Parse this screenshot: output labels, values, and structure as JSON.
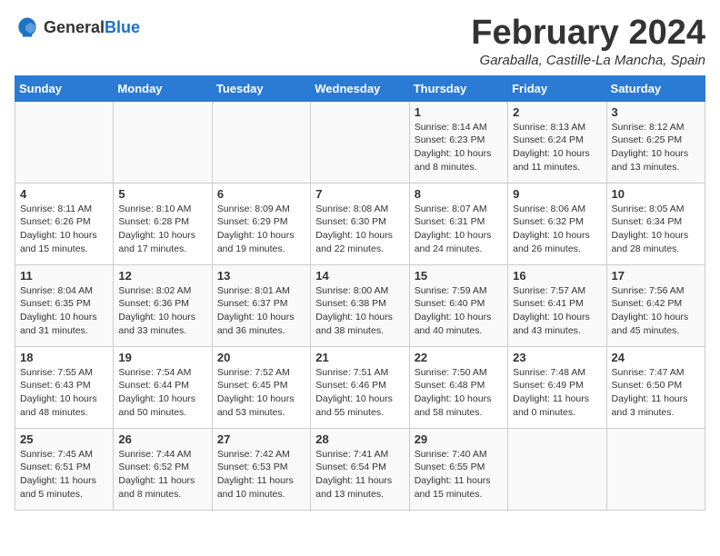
{
  "header": {
    "logo_general": "General",
    "logo_blue": "Blue",
    "month_year": "February 2024",
    "location": "Garaballa, Castille-La Mancha, Spain"
  },
  "days_of_week": [
    "Sunday",
    "Monday",
    "Tuesday",
    "Wednesday",
    "Thursday",
    "Friday",
    "Saturday"
  ],
  "weeks": [
    [
      {
        "day": "",
        "info": ""
      },
      {
        "day": "",
        "info": ""
      },
      {
        "day": "",
        "info": ""
      },
      {
        "day": "",
        "info": ""
      },
      {
        "day": "1",
        "info": "Sunrise: 8:14 AM\nSunset: 6:23 PM\nDaylight: 10 hours\nand 8 minutes."
      },
      {
        "day": "2",
        "info": "Sunrise: 8:13 AM\nSunset: 6:24 PM\nDaylight: 10 hours\nand 11 minutes."
      },
      {
        "day": "3",
        "info": "Sunrise: 8:12 AM\nSunset: 6:25 PM\nDaylight: 10 hours\nand 13 minutes."
      }
    ],
    [
      {
        "day": "4",
        "info": "Sunrise: 8:11 AM\nSunset: 6:26 PM\nDaylight: 10 hours\nand 15 minutes."
      },
      {
        "day": "5",
        "info": "Sunrise: 8:10 AM\nSunset: 6:28 PM\nDaylight: 10 hours\nand 17 minutes."
      },
      {
        "day": "6",
        "info": "Sunrise: 8:09 AM\nSunset: 6:29 PM\nDaylight: 10 hours\nand 19 minutes."
      },
      {
        "day": "7",
        "info": "Sunrise: 8:08 AM\nSunset: 6:30 PM\nDaylight: 10 hours\nand 22 minutes."
      },
      {
        "day": "8",
        "info": "Sunrise: 8:07 AM\nSunset: 6:31 PM\nDaylight: 10 hours\nand 24 minutes."
      },
      {
        "day": "9",
        "info": "Sunrise: 8:06 AM\nSunset: 6:32 PM\nDaylight: 10 hours\nand 26 minutes."
      },
      {
        "day": "10",
        "info": "Sunrise: 8:05 AM\nSunset: 6:34 PM\nDaylight: 10 hours\nand 28 minutes."
      }
    ],
    [
      {
        "day": "11",
        "info": "Sunrise: 8:04 AM\nSunset: 6:35 PM\nDaylight: 10 hours\nand 31 minutes."
      },
      {
        "day": "12",
        "info": "Sunrise: 8:02 AM\nSunset: 6:36 PM\nDaylight: 10 hours\nand 33 minutes."
      },
      {
        "day": "13",
        "info": "Sunrise: 8:01 AM\nSunset: 6:37 PM\nDaylight: 10 hours\nand 36 minutes."
      },
      {
        "day": "14",
        "info": "Sunrise: 8:00 AM\nSunset: 6:38 PM\nDaylight: 10 hours\nand 38 minutes."
      },
      {
        "day": "15",
        "info": "Sunrise: 7:59 AM\nSunset: 6:40 PM\nDaylight: 10 hours\nand 40 minutes."
      },
      {
        "day": "16",
        "info": "Sunrise: 7:57 AM\nSunset: 6:41 PM\nDaylight: 10 hours\nand 43 minutes."
      },
      {
        "day": "17",
        "info": "Sunrise: 7:56 AM\nSunset: 6:42 PM\nDaylight: 10 hours\nand 45 minutes."
      }
    ],
    [
      {
        "day": "18",
        "info": "Sunrise: 7:55 AM\nSunset: 6:43 PM\nDaylight: 10 hours\nand 48 minutes."
      },
      {
        "day": "19",
        "info": "Sunrise: 7:54 AM\nSunset: 6:44 PM\nDaylight: 10 hours\nand 50 minutes."
      },
      {
        "day": "20",
        "info": "Sunrise: 7:52 AM\nSunset: 6:45 PM\nDaylight: 10 hours\nand 53 minutes."
      },
      {
        "day": "21",
        "info": "Sunrise: 7:51 AM\nSunset: 6:46 PM\nDaylight: 10 hours\nand 55 minutes."
      },
      {
        "day": "22",
        "info": "Sunrise: 7:50 AM\nSunset: 6:48 PM\nDaylight: 10 hours\nand 58 minutes."
      },
      {
        "day": "23",
        "info": "Sunrise: 7:48 AM\nSunset: 6:49 PM\nDaylight: 11 hours\nand 0 minutes."
      },
      {
        "day": "24",
        "info": "Sunrise: 7:47 AM\nSunset: 6:50 PM\nDaylight: 11 hours\nand 3 minutes."
      }
    ],
    [
      {
        "day": "25",
        "info": "Sunrise: 7:45 AM\nSunset: 6:51 PM\nDaylight: 11 hours\nand 5 minutes."
      },
      {
        "day": "26",
        "info": "Sunrise: 7:44 AM\nSunset: 6:52 PM\nDaylight: 11 hours\nand 8 minutes."
      },
      {
        "day": "27",
        "info": "Sunrise: 7:42 AM\nSunset: 6:53 PM\nDaylight: 11 hours\nand 10 minutes."
      },
      {
        "day": "28",
        "info": "Sunrise: 7:41 AM\nSunset: 6:54 PM\nDaylight: 11 hours\nand 13 minutes."
      },
      {
        "day": "29",
        "info": "Sunrise: 7:40 AM\nSunset: 6:55 PM\nDaylight: 11 hours\nand 15 minutes."
      },
      {
        "day": "",
        "info": ""
      },
      {
        "day": "",
        "info": ""
      }
    ]
  ]
}
